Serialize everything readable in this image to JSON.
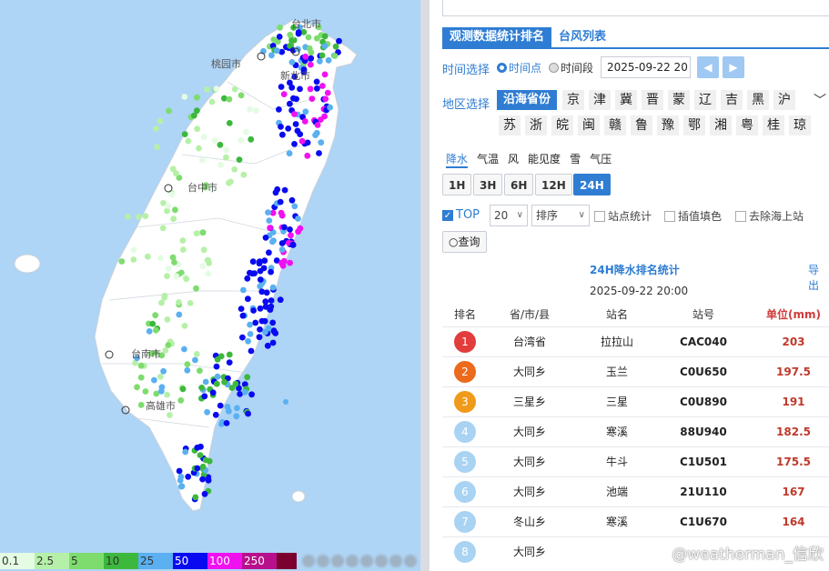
{
  "map": {
    "city_labels": [
      "台北市",
      "桃园市",
      "新北市",
      "台中市",
      "台南市",
      "高雄市"
    ],
    "legend": [
      {
        "label": "0.1",
        "color": "#e4fbe4"
      },
      {
        "label": "2.5",
        "color": "#b6f0a8"
      },
      {
        "label": "5",
        "color": "#7edc6e"
      },
      {
        "label": "10",
        "color": "#3cb83c"
      },
      {
        "label": "25",
        "color": "#5ab0f0"
      },
      {
        "label": "50",
        "color": "#0a0af0"
      },
      {
        "label": "100",
        "color": "#f010f0"
      },
      {
        "label": "250",
        "color": "#b8108c"
      },
      {
        "label": "",
        "color": "#7a0030"
      }
    ]
  },
  "panel": {
    "tabs": [
      "观测数据统计排名",
      "台风列表"
    ],
    "time_label": "时间选择",
    "time_point": "时间点",
    "time_range": "时间段",
    "date_value": "2025-09-22 20",
    "region_label": "地区选择",
    "region_active": "沿海省份",
    "regions_row1": [
      "京",
      "津",
      "冀",
      "晋",
      "蒙",
      "辽",
      "吉",
      "黑",
      "沪"
    ],
    "regions_row2": [
      "苏",
      "浙",
      "皖",
      "闽",
      "赣",
      "鲁",
      "豫",
      "鄂",
      "湘",
      "粤",
      "桂",
      "琼"
    ],
    "elements": [
      "降水",
      "气温",
      "风",
      "能见度",
      "雪",
      "气压"
    ],
    "hours": [
      "1H",
      "3H",
      "6H",
      "12H",
      "24H"
    ],
    "top_label": "TOP",
    "top_value": "20",
    "sort_label": "排序",
    "option_station": "站点统计",
    "option_interp": "插值填色",
    "option_sea": "去除海上站",
    "query": "查询",
    "stat_title": "24H降水排名统计",
    "export": "导出",
    "stat_time": "2025-09-22 20:00",
    "headers": [
      "排名",
      "省/市/县",
      "站名",
      "站号",
      "单位(mm)"
    ],
    "rows": [
      {
        "rank": "1",
        "region": "台湾省",
        "name": "拉拉山",
        "code": "CAC040",
        "value": "203",
        "badge": "#e23c3c"
      },
      {
        "rank": "2",
        "region": "大同乡",
        "name": "玉兰",
        "code": "C0U650",
        "value": "197.5",
        "badge": "#ec6a1c"
      },
      {
        "rank": "3",
        "region": "三星乡",
        "name": "三星",
        "code": "C0U890",
        "value": "191",
        "badge": "#f09a1a"
      },
      {
        "rank": "4",
        "region": "大同乡",
        "name": "寒溪",
        "code": "88U940",
        "value": "182.5",
        "badge": "#a9d3f3"
      },
      {
        "rank": "5",
        "region": "大同乡",
        "name": "牛斗",
        "code": "C1U501",
        "value": "175.5",
        "badge": "#a9d3f3"
      },
      {
        "rank": "6",
        "region": "大同乡",
        "name": "池端",
        "code": "21U110",
        "value": "167",
        "badge": "#a9d3f3"
      },
      {
        "rank": "7",
        "region": "冬山乡",
        "name": "寒溪",
        "code": "C1U670",
        "value": "164",
        "badge": "#a9d3f3"
      },
      {
        "rank": "8",
        "region": "大同乡",
        "name": "",
        "code": "",
        "value": "",
        "badge": "#a9d3f3"
      }
    ],
    "watermark": "@weatherman_信欣"
  }
}
